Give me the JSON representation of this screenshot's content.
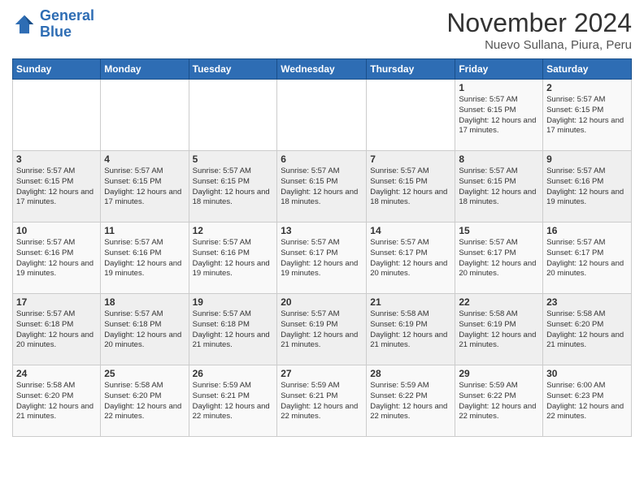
{
  "logo": {
    "line1": "General",
    "line2": "Blue"
  },
  "header": {
    "month": "November 2024",
    "location": "Nuevo  Sullana, Piura, Peru"
  },
  "days_of_week": [
    "Sunday",
    "Monday",
    "Tuesday",
    "Wednesday",
    "Thursday",
    "Friday",
    "Saturday"
  ],
  "weeks": [
    [
      {
        "day": "",
        "info": ""
      },
      {
        "day": "",
        "info": ""
      },
      {
        "day": "",
        "info": ""
      },
      {
        "day": "",
        "info": ""
      },
      {
        "day": "",
        "info": ""
      },
      {
        "day": "1",
        "info": "Sunrise: 5:57 AM\nSunset: 6:15 PM\nDaylight: 12 hours and 17 minutes."
      },
      {
        "day": "2",
        "info": "Sunrise: 5:57 AM\nSunset: 6:15 PM\nDaylight: 12 hours and 17 minutes."
      }
    ],
    [
      {
        "day": "3",
        "info": "Sunrise: 5:57 AM\nSunset: 6:15 PM\nDaylight: 12 hours and 17 minutes."
      },
      {
        "day": "4",
        "info": "Sunrise: 5:57 AM\nSunset: 6:15 PM\nDaylight: 12 hours and 17 minutes."
      },
      {
        "day": "5",
        "info": "Sunrise: 5:57 AM\nSunset: 6:15 PM\nDaylight: 12 hours and 18 minutes."
      },
      {
        "day": "6",
        "info": "Sunrise: 5:57 AM\nSunset: 6:15 PM\nDaylight: 12 hours and 18 minutes."
      },
      {
        "day": "7",
        "info": "Sunrise: 5:57 AM\nSunset: 6:15 PM\nDaylight: 12 hours and 18 minutes."
      },
      {
        "day": "8",
        "info": "Sunrise: 5:57 AM\nSunset: 6:15 PM\nDaylight: 12 hours and 18 minutes."
      },
      {
        "day": "9",
        "info": "Sunrise: 5:57 AM\nSunset: 6:16 PM\nDaylight: 12 hours and 19 minutes."
      }
    ],
    [
      {
        "day": "10",
        "info": "Sunrise: 5:57 AM\nSunset: 6:16 PM\nDaylight: 12 hours and 19 minutes."
      },
      {
        "day": "11",
        "info": "Sunrise: 5:57 AM\nSunset: 6:16 PM\nDaylight: 12 hours and 19 minutes."
      },
      {
        "day": "12",
        "info": "Sunrise: 5:57 AM\nSunset: 6:16 PM\nDaylight: 12 hours and 19 minutes."
      },
      {
        "day": "13",
        "info": "Sunrise: 5:57 AM\nSunset: 6:17 PM\nDaylight: 12 hours and 19 minutes."
      },
      {
        "day": "14",
        "info": "Sunrise: 5:57 AM\nSunset: 6:17 PM\nDaylight: 12 hours and 20 minutes."
      },
      {
        "day": "15",
        "info": "Sunrise: 5:57 AM\nSunset: 6:17 PM\nDaylight: 12 hours and 20 minutes."
      },
      {
        "day": "16",
        "info": "Sunrise: 5:57 AM\nSunset: 6:17 PM\nDaylight: 12 hours and 20 minutes."
      }
    ],
    [
      {
        "day": "17",
        "info": "Sunrise: 5:57 AM\nSunset: 6:18 PM\nDaylight: 12 hours and 20 minutes."
      },
      {
        "day": "18",
        "info": "Sunrise: 5:57 AM\nSunset: 6:18 PM\nDaylight: 12 hours and 20 minutes."
      },
      {
        "day": "19",
        "info": "Sunrise: 5:57 AM\nSunset: 6:18 PM\nDaylight: 12 hours and 21 minutes."
      },
      {
        "day": "20",
        "info": "Sunrise: 5:57 AM\nSunset: 6:19 PM\nDaylight: 12 hours and 21 minutes."
      },
      {
        "day": "21",
        "info": "Sunrise: 5:58 AM\nSunset: 6:19 PM\nDaylight: 12 hours and 21 minutes."
      },
      {
        "day": "22",
        "info": "Sunrise: 5:58 AM\nSunset: 6:19 PM\nDaylight: 12 hours and 21 minutes."
      },
      {
        "day": "23",
        "info": "Sunrise: 5:58 AM\nSunset: 6:20 PM\nDaylight: 12 hours and 21 minutes."
      }
    ],
    [
      {
        "day": "24",
        "info": "Sunrise: 5:58 AM\nSunset: 6:20 PM\nDaylight: 12 hours and 21 minutes."
      },
      {
        "day": "25",
        "info": "Sunrise: 5:58 AM\nSunset: 6:20 PM\nDaylight: 12 hours and 22 minutes."
      },
      {
        "day": "26",
        "info": "Sunrise: 5:59 AM\nSunset: 6:21 PM\nDaylight: 12 hours and 22 minutes."
      },
      {
        "day": "27",
        "info": "Sunrise: 5:59 AM\nSunset: 6:21 PM\nDaylight: 12 hours and 22 minutes."
      },
      {
        "day": "28",
        "info": "Sunrise: 5:59 AM\nSunset: 6:22 PM\nDaylight: 12 hours and 22 minutes."
      },
      {
        "day": "29",
        "info": "Sunrise: 5:59 AM\nSunset: 6:22 PM\nDaylight: 12 hours and 22 minutes."
      },
      {
        "day": "30",
        "info": "Sunrise: 6:00 AM\nSunset: 6:23 PM\nDaylight: 12 hours and 22 minutes."
      }
    ]
  ]
}
